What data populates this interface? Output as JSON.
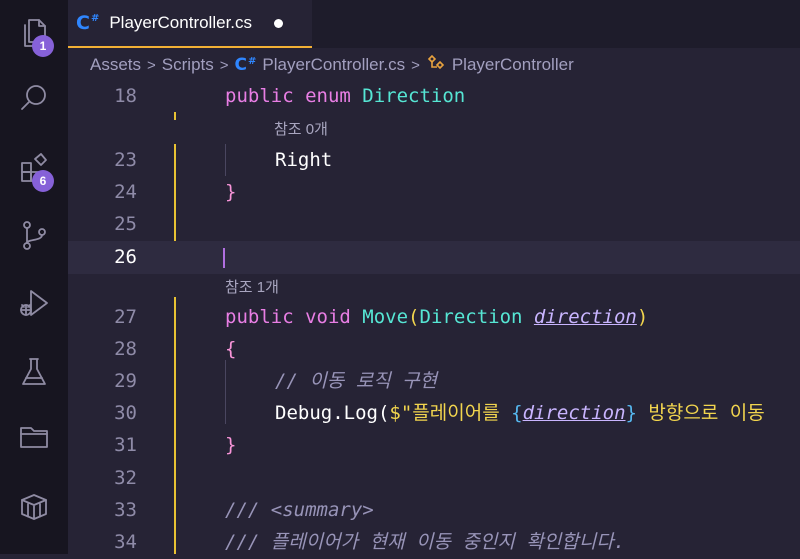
{
  "activity_bar": {
    "explorer_badge": "1",
    "extensions_badge": "6",
    "icons": [
      "files-icon",
      "search-icon",
      "extensions-icon",
      "source-control-icon",
      "run-debug-icon",
      "testing-icon",
      "folder-icon",
      "package-icon"
    ]
  },
  "tab": {
    "title": "PlayerController.cs",
    "icon": "C#",
    "modified": true
  },
  "breadcrumb": {
    "items": [
      "Assets",
      "Scripts",
      "PlayerController.cs",
      "PlayerController"
    ],
    "separator": ">"
  },
  "editor": {
    "current_line": "26",
    "lines": [
      {
        "n": "18",
        "tokens": [
          [
            "kw",
            "public "
          ],
          [
            "kw",
            "enum "
          ],
          [
            "type",
            "Direction"
          ]
        ]
      },
      {
        "n": "23",
        "tokens": [
          [
            "plain",
            "Right"
          ]
        ]
      },
      {
        "n": "24",
        "tokens": [
          [
            "brace",
            "}"
          ]
        ]
      },
      {
        "n": "25",
        "tokens": []
      },
      {
        "n": "26",
        "tokens": []
      },
      {
        "n": "27",
        "tokens": [
          [
            "kw",
            "public "
          ],
          [
            "kw",
            "void "
          ],
          [
            "fn",
            "Move"
          ],
          [
            "paren",
            "("
          ],
          [
            "type",
            "Direction "
          ],
          [
            "param",
            "direction"
          ],
          [
            "paren",
            ")"
          ]
        ]
      },
      {
        "n": "28",
        "tokens": [
          [
            "brace",
            "{"
          ]
        ]
      },
      {
        "n": "29",
        "tokens": [
          [
            "comment",
            "// 이동 로직 구현"
          ]
        ]
      },
      {
        "n": "30",
        "tokens": [
          [
            "plain",
            "Debug.Log("
          ],
          [
            "str",
            "$\"플레이어를 "
          ],
          [
            "ibrace",
            "{"
          ],
          [
            "param",
            "direction"
          ],
          [
            "ibrace",
            "}"
          ],
          [
            "str",
            " 방향으로 이동"
          ]
        ]
      },
      {
        "n": "31",
        "tokens": [
          [
            "brace",
            "}"
          ]
        ]
      },
      {
        "n": "32",
        "tokens": []
      },
      {
        "n": "33",
        "tokens": [
          [
            "comment",
            "/// <summary>"
          ]
        ]
      },
      {
        "n": "34",
        "tokens": [
          [
            "comment",
            "/// 플레이어가 현재 이동 중인지 확인합니다."
          ]
        ]
      }
    ],
    "codelens": [
      "참조 0개",
      "참조 1개"
    ]
  },
  "colors": {
    "background": "#262335",
    "accent_tab_border": "#f2b035",
    "keyword": "#e87ee4",
    "type": "#56e6d4",
    "badge": "#8661d8"
  }
}
